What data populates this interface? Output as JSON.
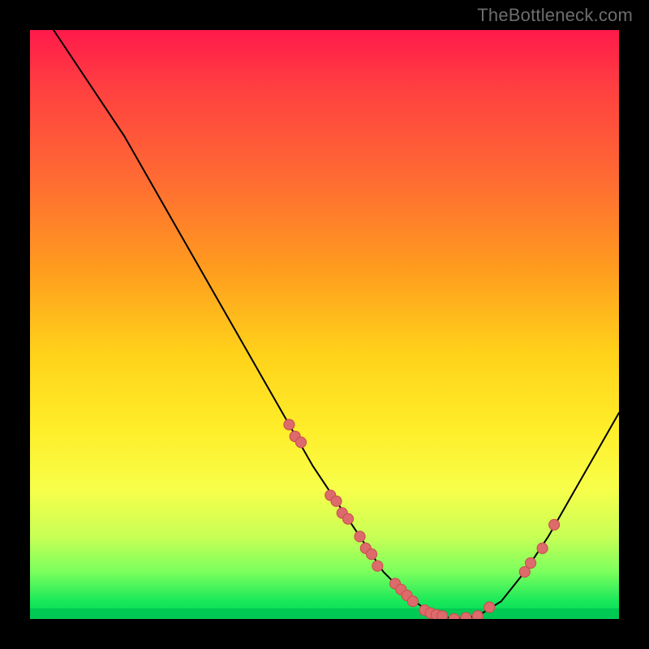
{
  "watermark": "TheBottleneck.com",
  "colors": {
    "background": "#000000",
    "curve": "#000000",
    "marker_fill": "#dd6b6b",
    "marker_stroke": "#c94f4f",
    "gradient_top": "#ff1a4b",
    "gradient_bottom": "#00d85a"
  },
  "chart_data": {
    "type": "line",
    "title": "",
    "xlabel": "",
    "ylabel": "",
    "xlim": [
      0,
      100
    ],
    "ylim": [
      0,
      100
    ],
    "grid": false,
    "annotations": [
      "TheBottleneck.com"
    ],
    "legend": false,
    "curve": [
      {
        "x": 4,
        "y": 100
      },
      {
        "x": 8,
        "y": 94
      },
      {
        "x": 12,
        "y": 88
      },
      {
        "x": 16,
        "y": 82
      },
      {
        "x": 20,
        "y": 75
      },
      {
        "x": 24,
        "y": 68
      },
      {
        "x": 28,
        "y": 61
      },
      {
        "x": 32,
        "y": 54
      },
      {
        "x": 36,
        "y": 47
      },
      {
        "x": 40,
        "y": 40
      },
      {
        "x": 44,
        "y": 33
      },
      {
        "x": 48,
        "y": 26
      },
      {
        "x": 52,
        "y": 20
      },
      {
        "x": 56,
        "y": 14
      },
      {
        "x": 60,
        "y": 8
      },
      {
        "x": 64,
        "y": 4
      },
      {
        "x": 68,
        "y": 1
      },
      {
        "x": 72,
        "y": 0
      },
      {
        "x": 76,
        "y": 0.5
      },
      {
        "x": 80,
        "y": 3
      },
      {
        "x": 84,
        "y": 8
      },
      {
        "x": 88,
        "y": 14
      },
      {
        "x": 92,
        "y": 21
      },
      {
        "x": 96,
        "y": 28
      },
      {
        "x": 100,
        "y": 35
      }
    ],
    "markers": [
      {
        "x": 44,
        "y": 33
      },
      {
        "x": 45,
        "y": 31
      },
      {
        "x": 46,
        "y": 30
      },
      {
        "x": 51,
        "y": 21
      },
      {
        "x": 52,
        "y": 20
      },
      {
        "x": 53,
        "y": 18
      },
      {
        "x": 54,
        "y": 17
      },
      {
        "x": 56,
        "y": 14
      },
      {
        "x": 57,
        "y": 12
      },
      {
        "x": 58,
        "y": 11
      },
      {
        "x": 59,
        "y": 9
      },
      {
        "x": 62,
        "y": 6
      },
      {
        "x": 63,
        "y": 5
      },
      {
        "x": 64,
        "y": 4
      },
      {
        "x": 65,
        "y": 3
      },
      {
        "x": 67,
        "y": 1.5
      },
      {
        "x": 68,
        "y": 1
      },
      {
        "x": 69,
        "y": 0.7
      },
      {
        "x": 70,
        "y": 0.5
      },
      {
        "x": 72,
        "y": 0
      },
      {
        "x": 74,
        "y": 0.2
      },
      {
        "x": 76,
        "y": 0.5
      },
      {
        "x": 78,
        "y": 2
      },
      {
        "x": 84,
        "y": 8
      },
      {
        "x": 85,
        "y": 9.5
      },
      {
        "x": 87,
        "y": 12
      },
      {
        "x": 89,
        "y": 16
      }
    ]
  }
}
